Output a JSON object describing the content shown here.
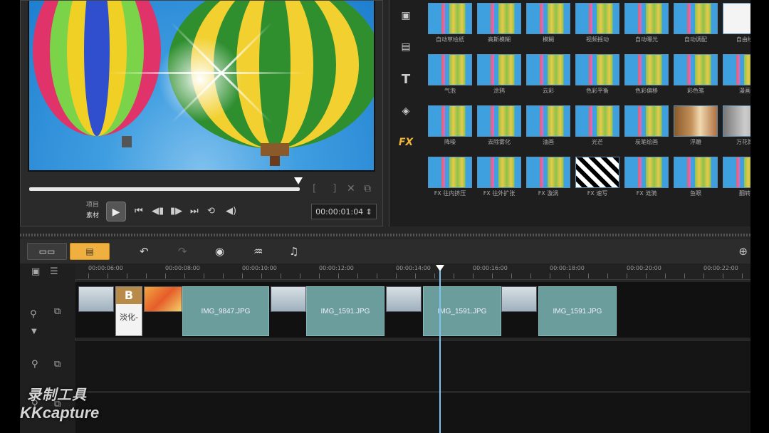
{
  "player": {
    "mode_project": "项目",
    "mode_clip": "素材",
    "play_icon": "play-icon",
    "timecode": "00:00:01:04",
    "trim_in": "[",
    "trim_out": "]",
    "controls": [
      "go-to-start-icon",
      "previous-frame-icon",
      "next-frame-icon",
      "go-to-end-icon",
      "repeat-icon",
      "volume-icon"
    ]
  },
  "library": {
    "side_icons": [
      "media-icon",
      "instant-project-icon",
      "title-icon",
      "graphic-icon",
      "filter-fx-icon"
    ],
    "fx_label": "FX",
    "title_glyph": "T",
    "filters": [
      [
        "自动草绘纸",
        "高斯模糊",
        "模糊",
        "视频摇动",
        "自动曝光",
        "自动调配",
        "自由绘"
      ],
      [
        "气泡",
        "涂鸦",
        "云彩",
        "色彩平衡",
        "色彩偏移",
        "彩色笔",
        "漫画"
      ],
      [
        "降噪",
        "去除雾化",
        "油画",
        "光芒",
        "炭笔绘画",
        "浮雕",
        "万花筒"
      ],
      [
        "FX 往内挤压",
        "FX 往外扩张",
        "FX 漩涡",
        "FX 速写",
        "FX 涟漪",
        "鱼眼",
        "翻转"
      ]
    ],
    "special_styles": {
      "2-5": "sepia",
      "3-3": "bw",
      "0-6": "white",
      "2-6": "gray"
    }
  },
  "toolbar": {
    "storyboard_view": "storyboard-view-icon",
    "timeline_view": "timeline-view-icon",
    "actions": [
      "undo-icon",
      "redo-icon",
      "record-capture-icon",
      "sound-mixer-icon",
      "auto-music-icon"
    ],
    "zoom": "zoom-icon"
  },
  "ruler": {
    "labels": [
      "00:00:06:00",
      "00:00:08:00",
      "00:00:10:00",
      "00:00:12:00",
      "00:00:14:00",
      "00:00:16:00",
      "00:00:18:00",
      "00:00:20:00",
      "00:00:22:00"
    ]
  },
  "tracks": {
    "video_clips": [
      "IMG_9847.JPG",
      "IMG_1591.JPG",
      "IMG_1591.JPG",
      "IMG_1591.JPG"
    ],
    "title_clip_glyph": "B",
    "title_clip_text": "淡化-"
  },
  "watermark": {
    "line1": "录制工具",
    "line2": "KKcapture"
  }
}
